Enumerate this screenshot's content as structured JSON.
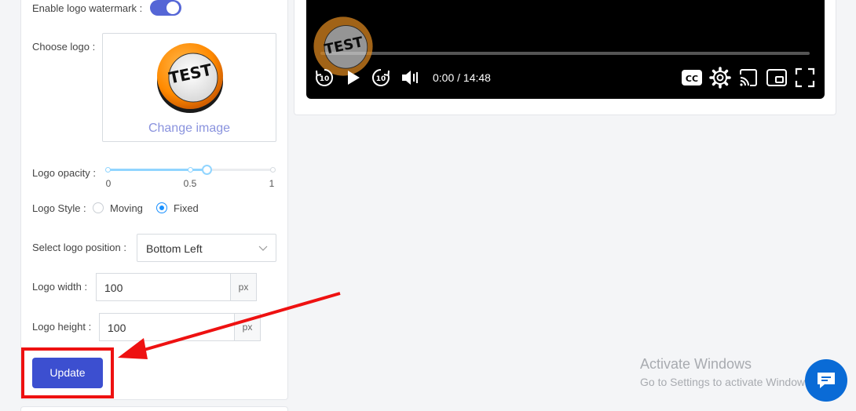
{
  "settings": {
    "enable_watermark_label": "Enable logo watermark :",
    "choose_logo_label": "Choose logo :",
    "logo_text": "TEST",
    "change_image": "Change image",
    "opacity_label": "Logo opacity :",
    "opacity_value": 0.6,
    "opacity_marks": [
      "0",
      "0.5",
      "1"
    ],
    "style_label": "Logo Style :",
    "style_options": [
      "Moving",
      "Fixed"
    ],
    "style_selected": "Fixed",
    "position_label": "Select logo position :",
    "position_value": "Bottom Left",
    "width_label": "Logo width :",
    "width_value": "100",
    "height_label": "Logo height :",
    "height_value": "100",
    "unit": "px",
    "update_button": "Update"
  },
  "player": {
    "time_display": "0:00 / 14:48",
    "rewind_seconds": "10",
    "forward_seconds": "10",
    "watermark_text": "TEST"
  },
  "os_notice": {
    "title": "Activate Windows",
    "subtitle": "Go to Settings to activate Windows."
  },
  "colors": {
    "primary": "#3c4fd0",
    "annotation": "#ee1111",
    "chat": "#0a6bd6"
  }
}
